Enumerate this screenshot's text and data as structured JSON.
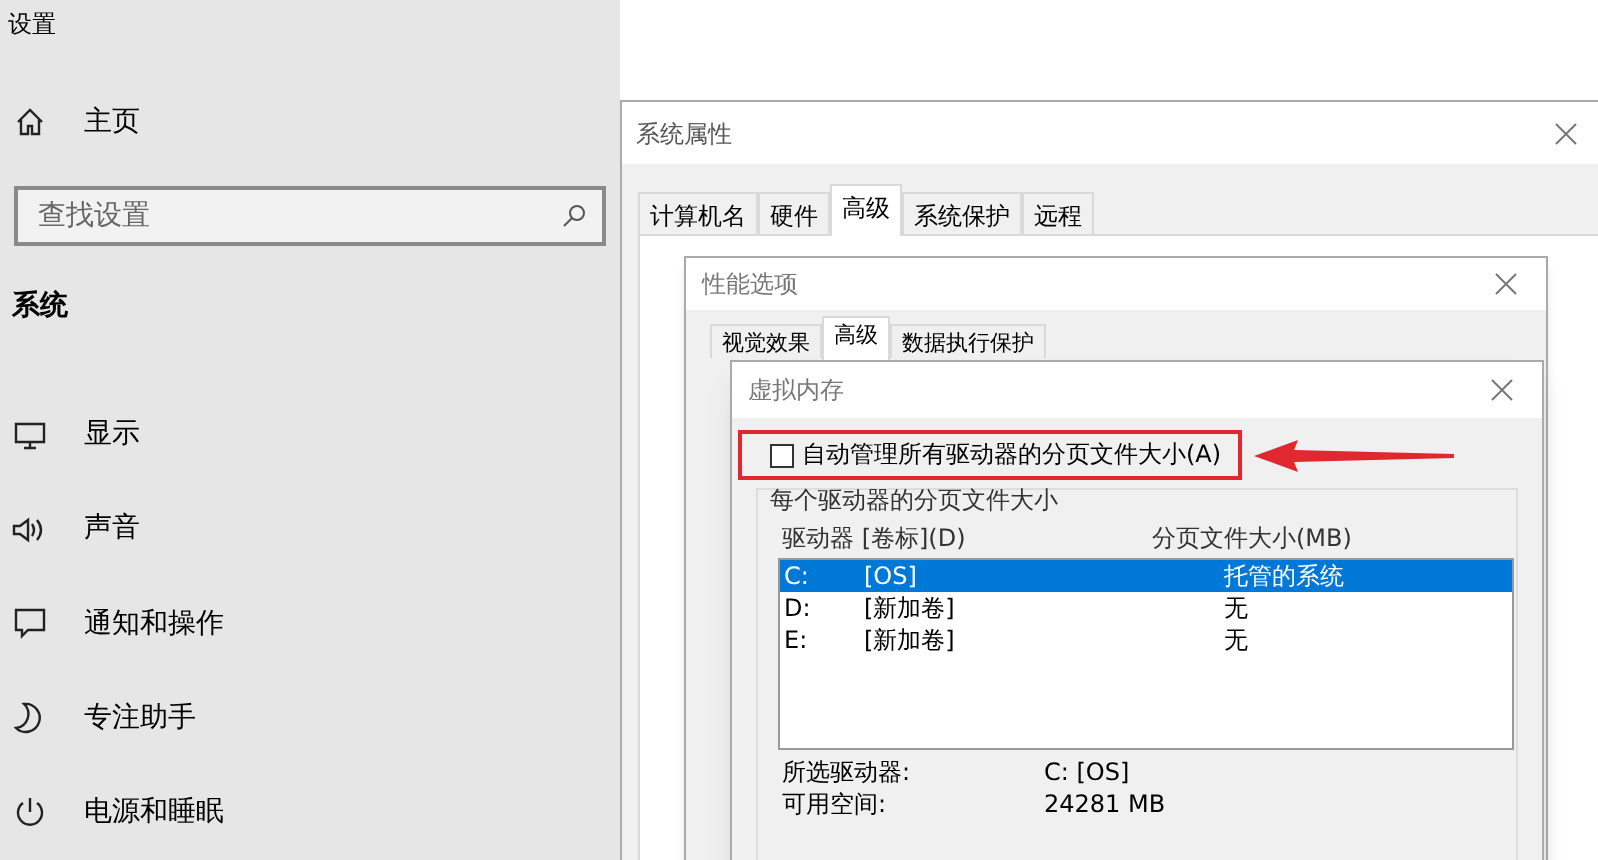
{
  "settings": {
    "title": "设置",
    "home": "主页",
    "search": {
      "placeholder": "查找设置"
    },
    "section": "系统",
    "nav": [
      {
        "label": "显示"
      },
      {
        "label": "声音"
      },
      {
        "label": "通知和操作"
      },
      {
        "label": "专注助手"
      },
      {
        "label": "电源和睡眠"
      }
    ]
  },
  "system_properties": {
    "title": "系统属性",
    "tabs": [
      {
        "label": "计算机名",
        "selected": false
      },
      {
        "label": "硬件",
        "selected": false
      },
      {
        "label": "高级",
        "selected": true
      },
      {
        "label": "系统保护",
        "selected": false
      },
      {
        "label": "远程",
        "selected": false
      }
    ]
  },
  "performance_options": {
    "title": "性能选项",
    "tabs": [
      {
        "label": "视觉效果",
        "selected": false
      },
      {
        "label": "高级",
        "selected": true
      },
      {
        "label": "数据执行保护",
        "selected": false
      }
    ]
  },
  "virtual_memory": {
    "title": "虚拟内存",
    "auto_manage": {
      "label": "自动管理所有驱动器的分页文件大小(A)",
      "checked": false
    },
    "group_label": "每个驱动器的分页文件大小",
    "columns": [
      "驱动器 [卷标](D)",
      "分页文件大小(MB)"
    ],
    "drives": [
      {
        "drive": "C:",
        "label": "[OS]",
        "size": "托管的系统",
        "selected": true
      },
      {
        "drive": "D:",
        "label": "[新加卷]",
        "size": "无",
        "selected": false
      },
      {
        "drive": "E:",
        "label": "[新加卷]",
        "size": "无",
        "selected": false
      }
    ],
    "selected_drive": {
      "label": "所选驱动器:",
      "value": "C:  [OS]"
    },
    "free_space": {
      "label": "可用空间:",
      "value": "24281 MB"
    }
  }
}
